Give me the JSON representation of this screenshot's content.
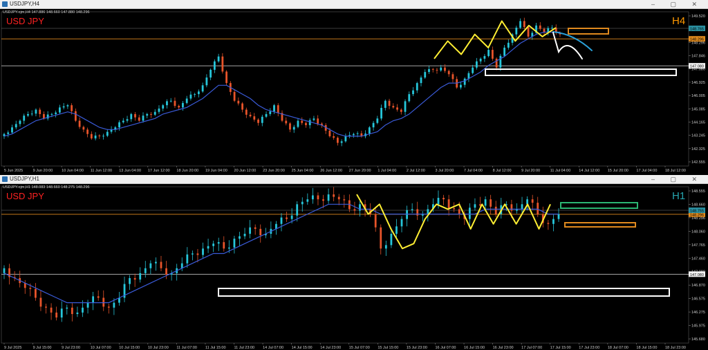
{
  "windows": [
    {
      "id": "h4",
      "title": "USDJPY,H4",
      "info": "USDJPY.ojm,H4  147.886 148.660 147.880 148.296",
      "symbol_label": "USD JPY",
      "timeframe_label": "H4",
      "window_buttons": "– ▢ ✕",
      "price_labels": [
        "149.520",
        "148.765",
        "148.296",
        "147.846",
        "147.080",
        "146.925",
        "146.005",
        "145.085",
        "144.165",
        "143.245",
        "142.325",
        "142.555"
      ],
      "price_tags": {
        "current": "148.296",
        "support": "147.080",
        "upper": "148.765"
      },
      "time_labels": [
        "5 Jun 2025",
        "9 Jun 20:00",
        "10 Jun 04:00",
        "11 Jun 12:00",
        "13 Jun 04:00",
        "17 Jun 12:00",
        "18 Jun 20:00",
        "19 Jun 04:00",
        "20 Jun 12:00",
        "23 Jun 20:00",
        "25 Jun 04:00",
        "26 Jun 12:00",
        "27 Jun 20:00",
        "1 Jul 04:00",
        "2 Jul 12:00",
        "3 Jul 20:00",
        "7 Jul 04:00",
        "8 Jul 12:00",
        "9 Jul 20:00",
        "11 Jul 04:00",
        "14 Jul 12:00",
        "15 Jul 20:00",
        "17 Jul 04:00",
        "18 Jul 12:00"
      ],
      "colors": {
        "bull": "#26c6da",
        "bear": "#e8542a",
        "ma": "#3a5bd9",
        "zigzag": "#ffee33",
        "label_red": "#ff2222",
        "tf_label": "#ff9900"
      }
    },
    {
      "id": "h1",
      "title": "USDJPY,H1",
      "info": "USDJPY.ojm,H1  148.083 148.660 148.275 148.296",
      "symbol_label": "USD JPY",
      "timeframe_label": "H1",
      "window_buttons": "– ▢ ✕",
      "price_labels": [
        "148.555",
        "148.660",
        "148.296",
        "148.060",
        "147.765",
        "147.460",
        "147.080",
        "146.870",
        "146.575",
        "146.275",
        "145.975",
        "145.680"
      ],
      "price_tags": {
        "current": "148.296",
        "support": "147.080",
        "upper": "148.755"
      },
      "time_labels": [
        "9 Jul 2025",
        "9 Jul 15:00",
        "9 Jul 23:00",
        "10 Jul 07:00",
        "10 Jul 15:00",
        "10 Jul 23:00",
        "11 Jul 07:00",
        "11 Jul 15:00",
        "11 Jul 23:00",
        "14 Jul 07:00",
        "14 Jul 15:00",
        "14 Jul 23:00",
        "15 Jul 07:00",
        "15 Jul 15:00",
        "15 Jul 23:00",
        "16 Jul 07:00",
        "16 Jul 15:00",
        "16 Jul 23:00",
        "17 Jul 07:00",
        "17 Jul 15:00",
        "17 Jul 23:00",
        "18 Jul 07:00",
        "18 Jul 15:00",
        "18 Jul 23:00"
      ],
      "colors": {
        "bull": "#26c6da",
        "bear": "#e8542a",
        "ma": "#3a5bd9",
        "zigzag": "#ffee33",
        "label_red": "#ff2222",
        "tf_label": "#26a6b0"
      }
    }
  ],
  "chart_data": [
    {
      "type": "line",
      "title": "USD JPY",
      "timeframe": "H4",
      "ylim": [
        142.555,
        149.52
      ],
      "x_ticks": [
        "5 Jun 2025",
        "9 Jun 20:00",
        "10 Jun 04:00",
        "11 Jun 12:00",
        "13 Jun 04:00",
        "17 Jun 12:00",
        "18 Jun 20:00",
        "19 Jun 04:00",
        "20 Jun 12:00",
        "23 Jun 20:00",
        "25 Jun 04:00",
        "26 Jun 12:00",
        "27 Jun 20:00",
        "1 Jul 04:00",
        "2 Jul 12:00",
        "3 Jul 20:00",
        "7 Jul 04:00",
        "8 Jul 12:00",
        "9 Jul 20:00",
        "11 Jul 04:00",
        "14 Jul 12:00",
        "15 Jul 20:00",
        "17 Jul 04:00",
        "18 Jul 12:00"
      ],
      "close_path": [
        144.0,
        144.3,
        144.6,
        144.9,
        145.1,
        144.7,
        144.9,
        145.2,
        145.3,
        144.6,
        144.2,
        143.8,
        143.9,
        144.1,
        144.3,
        144.6,
        144.9,
        144.6,
        144.9,
        145.0,
        145.3,
        145.5,
        145.2,
        145.6,
        145.8,
        146.2,
        146.9,
        147.5,
        146.3,
        145.5,
        145.1,
        144.8,
        144.5,
        144.9,
        145.3,
        144.6,
        144.2,
        144.6,
        144.4,
        144.7,
        144.4,
        143.9,
        143.6,
        143.9,
        144.0,
        143.9,
        144.3,
        144.7,
        145.5,
        145.2,
        145.0,
        145.8,
        146.3,
        146.8,
        146.9,
        147.0,
        146.7,
        146.1,
        146.5,
        147.0,
        147.4,
        147.8,
        147.0,
        147.9,
        148.5,
        149.1,
        148.4,
        148.9,
        148.6,
        148.8,
        148.5
      ],
      "ma_path": [
        143.9,
        144.0,
        144.2,
        144.4,
        144.6,
        144.7,
        144.8,
        144.9,
        145.0,
        144.9,
        144.7,
        144.5,
        144.3,
        144.2,
        144.2,
        144.3,
        144.4,
        144.5,
        144.6,
        144.7,
        144.9,
        145.0,
        145.1,
        145.2,
        145.4,
        145.6,
        145.9,
        146.2,
        146.2,
        146.0,
        145.8,
        145.6,
        145.3,
        145.1,
        145.0,
        144.9,
        144.8,
        144.7,
        144.6,
        144.5,
        144.4,
        144.2,
        144.0,
        143.9,
        143.9,
        143.9,
        144.0,
        144.1,
        144.4,
        144.6,
        144.7,
        144.9,
        145.2,
        145.5,
        145.8,
        146.1,
        146.3,
        146.3,
        146.4,
        146.6,
        146.8,
        147.1,
        147.3,
        147.5,
        147.8,
        148.1,
        148.3,
        148.5,
        148.6,
        148.6,
        148.6
      ],
      "zigzag": [
        147.4,
        148.2,
        147.6,
        148.5,
        147.9,
        149.1,
        148.2,
        148.9,
        148.4,
        148.8
      ],
      "levels": [
        148.296,
        147.08
      ]
    },
    {
      "type": "line",
      "title": "USD JPY",
      "timeframe": "H1",
      "ylim": [
        145.68,
        148.855
      ],
      "x_ticks": [
        "9 Jul 2025",
        "9 Jul 15:00",
        "9 Jul 23:00",
        "10 Jul 07:00",
        "10 Jul 15:00",
        "10 Jul 23:00",
        "11 Jul 07:00",
        "11 Jul 15:00",
        "11 Jul 23:00",
        "14 Jul 07:00",
        "14 Jul 15:00",
        "14 Jul 23:00",
        "15 Jul 07:00",
        "15 Jul 15:00",
        "15 Jul 23:00",
        "16 Jul 07:00",
        "16 Jul 15:00",
        "16 Jul 23:00",
        "17 Jul 07:00",
        "17 Jul 15:00",
        "17 Jul 23:00",
        "18 Jul 07:00",
        "18 Jul 15:00",
        "18 Jul 23:00"
      ],
      "close_path": [
        147.2,
        147.0,
        146.8,
        146.6,
        146.4,
        146.2,
        146.4,
        146.3,
        146.5,
        146.6,
        146.4,
        146.6,
        147.0,
        147.1,
        147.3,
        147.2,
        147.1,
        147.3,
        147.5,
        147.6,
        147.7,
        147.6,
        147.8,
        147.9,
        148.0,
        147.9,
        148.1,
        148.2,
        148.5,
        148.6,
        148.6,
        148.7,
        148.6,
        148.4,
        148.5,
        148.3,
        147.6,
        147.9,
        148.2,
        148.4,
        148.3,
        148.5,
        148.6,
        148.4,
        148.2,
        148.5,
        148.6,
        148.3,
        148.5,
        148.4,
        148.6,
        148.3,
        148.1,
        148.3
      ],
      "ma_path": [
        147.1,
        147.0,
        146.9,
        146.8,
        146.7,
        146.6,
        146.5,
        146.5,
        146.5,
        146.5,
        146.5,
        146.6,
        146.7,
        146.8,
        146.9,
        147.0,
        147.1,
        147.2,
        147.3,
        147.4,
        147.5,
        147.5,
        147.6,
        147.7,
        147.8,
        147.9,
        148.0,
        148.1,
        148.2,
        148.3,
        148.4,
        148.5,
        148.5,
        148.5,
        148.4,
        148.4,
        148.3,
        148.3,
        148.3,
        148.3,
        148.3,
        148.3,
        148.3,
        148.3,
        148.3,
        148.3,
        148.4,
        148.4,
        148.4,
        148.4,
        148.4,
        148.4,
        148.3,
        148.3
      ],
      "zigzag": [
        148.7,
        148.3,
        148.5,
        148.0,
        147.6,
        147.7,
        148.2,
        148.5,
        148.4,
        148.5,
        148.0,
        148.5,
        148.1,
        148.5,
        148.1,
        148.5,
        148.0,
        148.5
      ],
      "levels": [
        148.296,
        147.08
      ]
    }
  ]
}
